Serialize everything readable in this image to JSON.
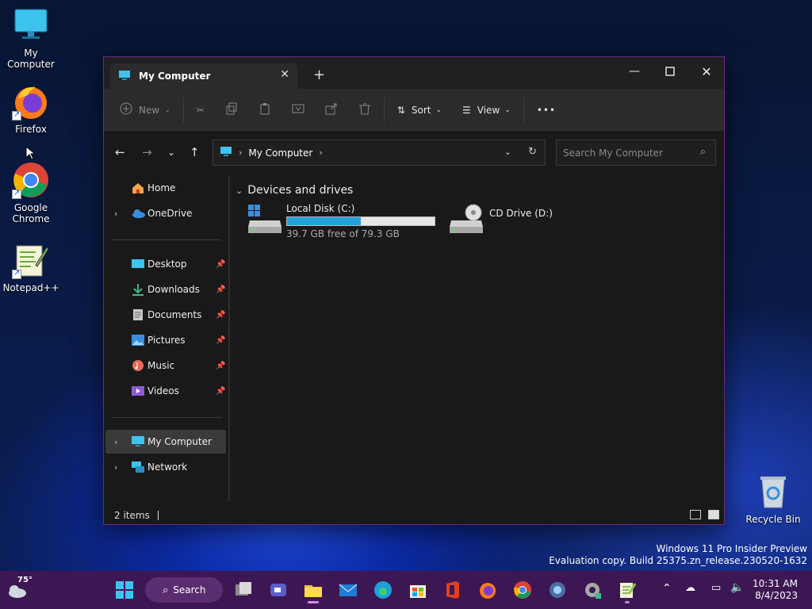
{
  "desktop": {
    "icons": [
      {
        "label": "My Computer"
      },
      {
        "label": "Firefox"
      },
      {
        "label": "Google Chrome"
      },
      {
        "label": "Notepad++"
      },
      {
        "label": "Recycle Bin"
      }
    ],
    "watermark": {
      "line1": "Windows 11 Pro Insider Preview",
      "line2": "Evaluation copy. Build 25375.zn_release.230520-1632"
    }
  },
  "window": {
    "tab_title": "My Computer",
    "toolbar": {
      "new_label": "New",
      "sort_label": "Sort",
      "view_label": "View",
      "more_label": "•••"
    },
    "address": {
      "crumb": "My Computer",
      "search_placeholder": "Search My Computer"
    },
    "sidebar": {
      "items": [
        {
          "label": "Home"
        },
        {
          "label": "OneDrive"
        },
        {
          "label": "Desktop"
        },
        {
          "label": "Downloads"
        },
        {
          "label": "Documents"
        },
        {
          "label": "Pictures"
        },
        {
          "label": "Music"
        },
        {
          "label": "Videos"
        },
        {
          "label": "My Computer"
        },
        {
          "label": "Network"
        }
      ]
    },
    "content": {
      "group_title": "Devices and drives",
      "drives": [
        {
          "name": "Local Disk (C:)",
          "free_text": "39.7 GB free of 79.3 GB",
          "used_fraction": 0.5
        },
        {
          "name": "CD Drive (D:)"
        }
      ]
    },
    "status": {
      "items_text": "2 items"
    }
  },
  "taskbar": {
    "weather_temp": "75°",
    "search_label": "Search",
    "time": "10:31 AM",
    "date": "8/4/2023"
  },
  "colors": {
    "accent": "#26a0da",
    "taskbar": "#3d1753",
    "window_border": "#6a2a7a"
  }
}
